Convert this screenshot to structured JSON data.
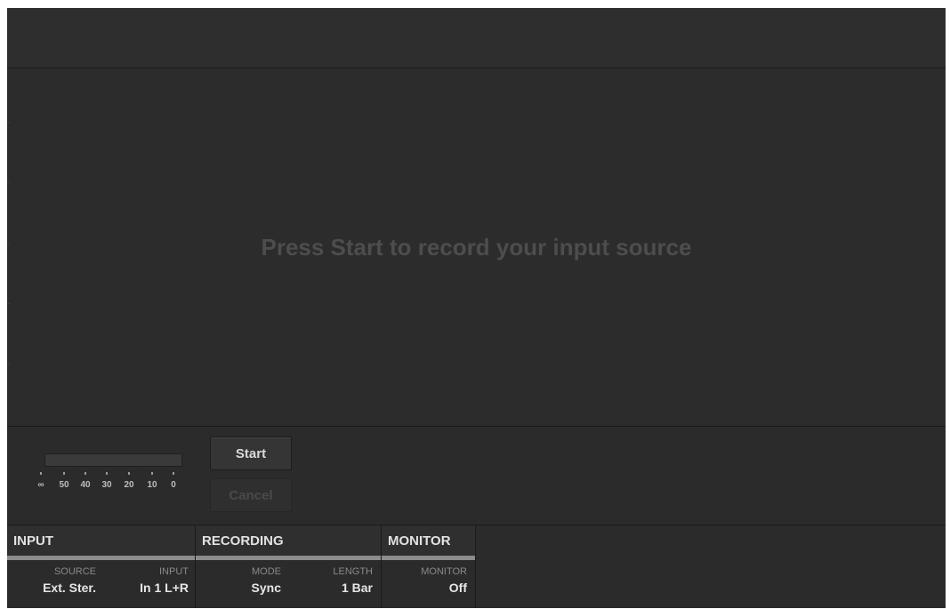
{
  "main": {
    "message": "Press Start to record your input source"
  },
  "meter": {
    "level": 0,
    "scale": [
      "∞",
      "50",
      "40",
      "30",
      "20",
      "10",
      "0"
    ]
  },
  "buttons": {
    "start": "Start",
    "cancel": "Cancel"
  },
  "sections": {
    "input": {
      "title": "INPUT",
      "source_label": "SOURCE",
      "source_value": "Ext. Ster.",
      "input_label": "INPUT",
      "input_value": "In 1 L+R"
    },
    "recording": {
      "title": "RECORDING",
      "mode_label": "MODE",
      "mode_value": "Sync",
      "length_label": "LENGTH",
      "length_value": "1 Bar"
    },
    "monitor": {
      "title": "MONITOR",
      "monitor_label": "MONITOR",
      "monitor_value": "Off"
    }
  }
}
